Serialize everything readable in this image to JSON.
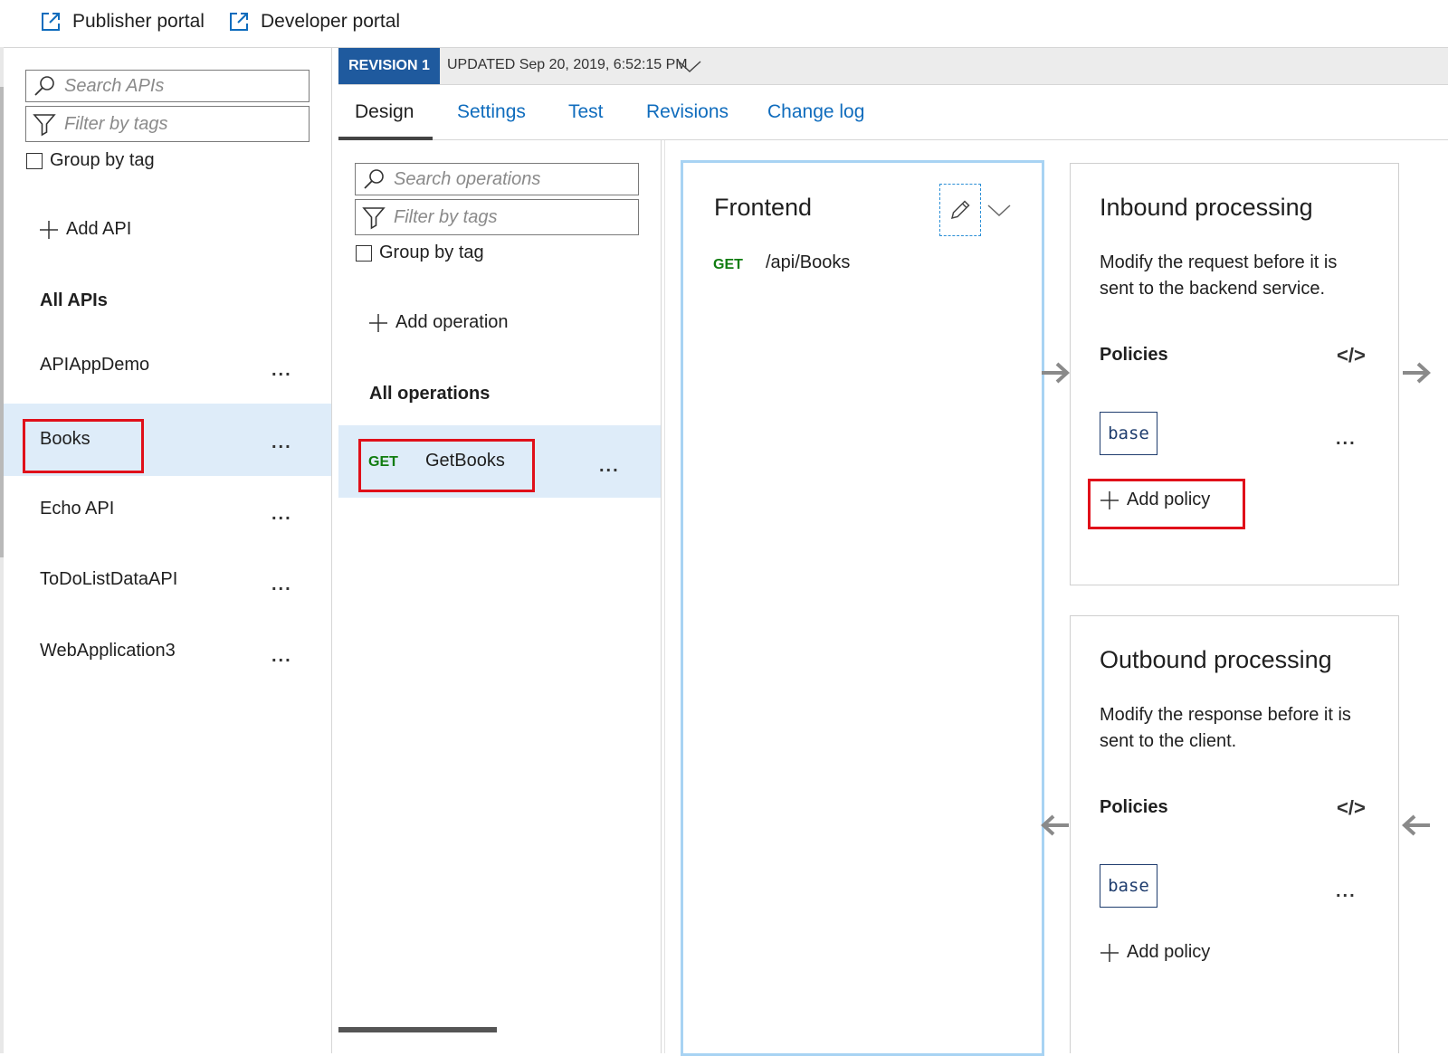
{
  "portal": {
    "publisher_label": "Publisher portal",
    "developer_label": "Developer portal"
  },
  "sidebar": {
    "search_placeholder": "Search APIs",
    "filter_placeholder": "Filter by tags",
    "group_by_label": "Group by tag",
    "add_api_label": "Add API",
    "all_apis_heading": "All APIs",
    "items": [
      {
        "label": "APIAppDemo",
        "more": "..."
      },
      {
        "label": "Books",
        "more": "..."
      },
      {
        "label": "Echo API",
        "more": "..."
      },
      {
        "label": "ToDoListDataAPI",
        "more": "..."
      },
      {
        "label": "WebApplication3",
        "more": "..."
      }
    ],
    "selected_item": "Books"
  },
  "revision_bar": {
    "badge": "REVISION 1",
    "updated_text": "UPDATED Sep 20, 2019, 6:52:15 PM"
  },
  "tabs": [
    {
      "label": "Design"
    },
    {
      "label": "Settings"
    },
    {
      "label": "Test"
    },
    {
      "label": "Revisions"
    },
    {
      "label": "Change log"
    }
  ],
  "operations": {
    "search_placeholder": "Search operations",
    "filter_placeholder": "Filter by tags",
    "group_by_label": "Group by tag",
    "add_operation_label": "Add operation",
    "all_operations_heading": "All operations",
    "items": [
      {
        "method": "GET",
        "name": "GetBooks",
        "more": "..."
      }
    ]
  },
  "frontend": {
    "title": "Frontend",
    "method": "GET",
    "path": "/api/Books"
  },
  "inbound": {
    "title": "Inbound processing",
    "description_line1": "Modify the request before it is",
    "description_line2": "sent to the backend service.",
    "policies_label": "Policies",
    "code_icon": "</>",
    "base_label": "base",
    "more": "...",
    "add_policy_label": "Add policy"
  },
  "outbound": {
    "title": "Outbound processing",
    "description_line1": "Modify the response before it is",
    "description_line2": "sent to the client.",
    "policies_label": "Policies",
    "code_icon": "</>",
    "base_label": "base",
    "more": "...",
    "add_policy_label": "Add policy"
  },
  "colors": {
    "accent": "#0f6cbd",
    "revision_badge": "#1f5a9e",
    "selected_bg": "#deecf9",
    "highlight": "#e0101a",
    "get_method": "#107c10"
  }
}
